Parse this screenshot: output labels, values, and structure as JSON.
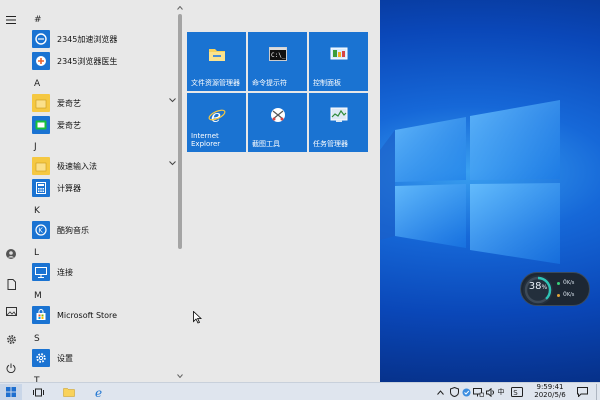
{
  "start_menu": {
    "app_list": {
      "sections": [
        {
          "letter": "#",
          "apps": [
            {
              "label": "2345加速浏览器",
              "icon": "2345-browser-icon"
            },
            {
              "label": "2345浏览器医生",
              "icon": "browser-doctor-icon"
            }
          ]
        },
        {
          "letter": "A",
          "apps": [
            {
              "label": "爱奇艺",
              "icon": "folder-icon",
              "expandable": true
            },
            {
              "label": "爱奇艺",
              "icon": "iqiyi-icon"
            }
          ]
        },
        {
          "letter": "J",
          "apps": [
            {
              "label": "极速输入法",
              "icon": "folder-icon",
              "expandable": true
            },
            {
              "label": "计算器",
              "icon": "calculator-icon"
            }
          ]
        },
        {
          "letter": "K",
          "apps": [
            {
              "label": "酷狗音乐",
              "icon": "kugou-icon"
            }
          ]
        },
        {
          "letter": "L",
          "apps": [
            {
              "label": "连接",
              "icon": "connect-icon"
            }
          ]
        },
        {
          "letter": "M",
          "apps": [
            {
              "label": "Microsoft Store",
              "icon": "store-icon"
            }
          ]
        },
        {
          "letter": "S",
          "apps": [
            {
              "label": "设置",
              "icon": "settings-icon"
            }
          ]
        },
        {
          "letter": "T",
          "apps": []
        }
      ]
    },
    "tiles": [
      {
        "label": "文件资源管理器",
        "icon": "file-explorer-icon"
      },
      {
        "label": "命令提示符",
        "icon": "command-prompt-icon"
      },
      {
        "label": "控制面板",
        "icon": "control-panel-icon"
      },
      {
        "label": "Internet Explorer",
        "icon": "internet-explorer-icon"
      },
      {
        "label": "截图工具",
        "icon": "snipping-tool-icon"
      },
      {
        "label": "任务管理器",
        "icon": "task-manager-icon"
      }
    ]
  },
  "net_widget": {
    "percent": "38",
    "percent_unit": "%",
    "upload": "0",
    "upload_unit": "K/s",
    "download": "0",
    "download_unit": "K/s",
    "percent_value": 0.38,
    "accent": "#2ec4b6"
  },
  "taskbar": {
    "input_method": "中",
    "time": "9:59:41",
    "date": "2020/5/6"
  },
  "colors": {
    "tile": "#1a73d2",
    "app_icon": "#1a73d2",
    "start_bg": "#e8e8e8",
    "taskbar": "#dfe5ee"
  }
}
